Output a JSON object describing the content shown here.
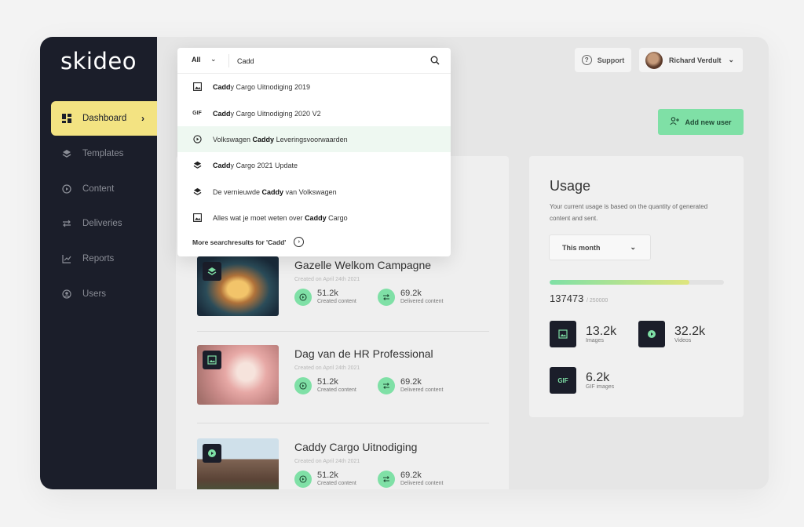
{
  "app": {
    "logo": "skideo"
  },
  "sidebar": {
    "items": [
      {
        "label": "Dashboard",
        "icon": "grid-icon",
        "active": true
      },
      {
        "label": "Templates",
        "icon": "layers-icon"
      },
      {
        "label": "Content",
        "icon": "play-circle-icon"
      },
      {
        "label": "Deliveries",
        "icon": "swap-icon"
      },
      {
        "label": "Reports",
        "icon": "chart-icon"
      },
      {
        "label": "Users",
        "icon": "user-circle-icon"
      }
    ]
  },
  "header": {
    "support_label": "Support",
    "user_name": "Richard Verdult",
    "add_user_label": "Add new user"
  },
  "search": {
    "scope": "All",
    "query": "Cadd",
    "results": [
      {
        "icon": "image-icon",
        "match": "Cadd",
        "pre": "",
        "post": "y Cargo Uitnodiging 2019"
      },
      {
        "icon": "gif-icon",
        "icon_text": "GIF",
        "match": "Cadd",
        "pre": "",
        "post": "y Cargo Uitnodiging 2020 V2"
      },
      {
        "icon": "play-circle-icon",
        "match": "Caddy",
        "pre": "Volkswagen ",
        "post": " Leveringsvoorwaarden",
        "highlighted": true
      },
      {
        "icon": "layers-icon",
        "match": "Cadd",
        "pre": "",
        "post": "y Cargo 2021 Update"
      },
      {
        "icon": "layers-icon",
        "match": "Caddy",
        "pre": "De vernieuwde ",
        "post": " van Volkswagen"
      },
      {
        "icon": "image-icon",
        "match": "Caddy",
        "pre": "Alles wat je moet weten over ",
        "post": " Cargo"
      }
    ],
    "more_label": "More searchresults for 'Cadd'"
  },
  "content": {
    "cards": [
      {
        "title": "Gazelle Welkom Campagne",
        "date": "Created on April 24th 2021",
        "created": "51.2k",
        "created_label": "Created content",
        "delivered": "69.2k",
        "delivered_label": "Delivered content",
        "badge": "layers-icon"
      },
      {
        "title": "Dag van de HR Professional",
        "date": "Created on April 24th 2021",
        "created": "51.2k",
        "created_label": "Created content",
        "delivered": "69.2k",
        "delivered_label": "Delivered content",
        "badge": "image-icon"
      },
      {
        "title": "Caddy Cargo Uitnodiging",
        "date": "Created on April 24th 2021",
        "created": "51.2k",
        "created_label": "Created content",
        "delivered": "69.2k",
        "delivered_label": "Delivered content",
        "badge": "play-icon"
      }
    ]
  },
  "usage": {
    "title": "Usage",
    "description": "Your current usage is based on the quantity of generated content and sent.",
    "period": "This month",
    "count": "137473",
    "max": "/ 250000",
    "progress_fraction": 0.8,
    "accent_color": "#7fe0a6",
    "metrics": [
      {
        "value": "13.2k",
        "label": "Images",
        "icon": "image-icon"
      },
      {
        "value": "32.2k",
        "label": "Videos",
        "icon": "play-icon"
      },
      {
        "value": "6.2k",
        "label": "GIF images",
        "icon": "gif-icon",
        "icon_text": "GIF"
      }
    ]
  }
}
